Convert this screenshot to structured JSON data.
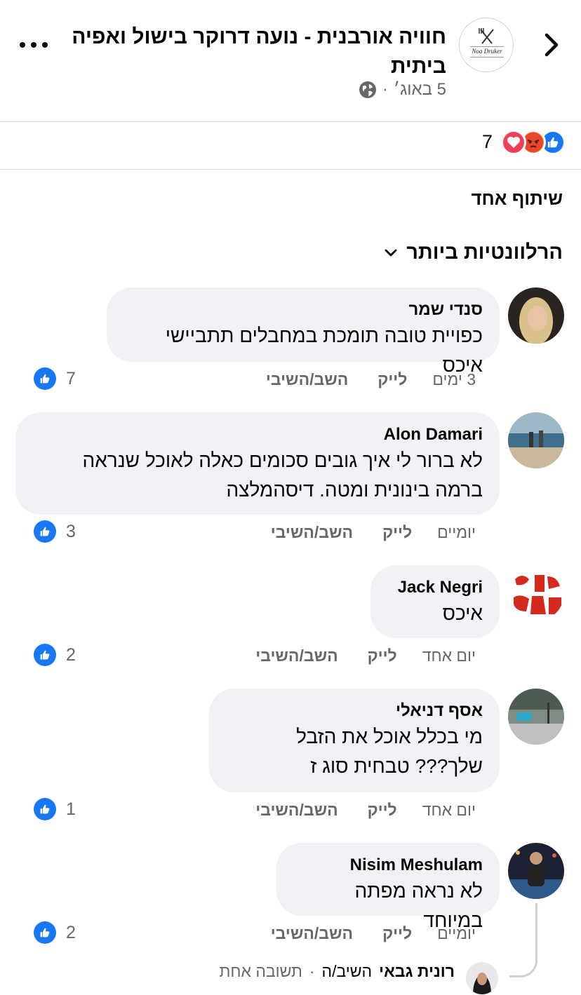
{
  "post": {
    "title": "חוויה אורבנית - נועה דרוקר בישול ואפיה ביתית",
    "date": "5 באוג׳",
    "separator": "·",
    "page_logo_text": "Noa Druker"
  },
  "reactions": {
    "count": "7",
    "icons": [
      "like-icon",
      "angry-icon",
      "love-icon"
    ]
  },
  "shares_label": "שיתוף אחד",
  "sort_label": "הרלוונטיות ביותר",
  "actions": {
    "like": "לייק",
    "reply": "השב/השיבי"
  },
  "comments": [
    {
      "name": "סנדי שמר",
      "text": "כפויית טובה תומכת במחבלים תתביישי איכס",
      "time": "3 ימים",
      "likes": "7"
    },
    {
      "name": "Alon Damari",
      "text": "לא ברור לי איך גובים סכומים כאלה לאוכל שנראה ברמה בינונית ומטה. דיסהמלצה",
      "time": "יומיים",
      "likes": "3"
    },
    {
      "name": "Jack Negri",
      "text": "איכס",
      "time": "יום אחד",
      "likes": "2"
    },
    {
      "name": "אסף דניאלי",
      "text": "מי בכלל אוכל את הזבל שלך??? טבחית סוג ז",
      "time": "יום אחד",
      "likes": "1"
    },
    {
      "name": "Nisim Meshulam",
      "text": "לא נראה מפתה במיוחד",
      "time": "יומיים",
      "likes": "2"
    }
  ],
  "reply_summary": {
    "name": "רונית גבאי",
    "verb": "השיב/ה",
    "separator": "·",
    "count": "תשובה אחת"
  },
  "colors": {
    "brand_blue": "#1877f2",
    "bubble_bg": "#f0f2f5",
    "secondary_text": "#65676b",
    "angry_orange": "#f0812c",
    "love_red": "#f33e58"
  }
}
